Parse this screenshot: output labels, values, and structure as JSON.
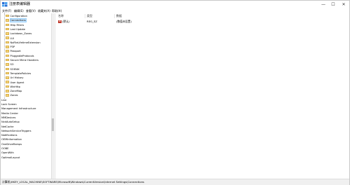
{
  "window": {
    "title": "注册表编辑器",
    "minimize": "—",
    "maximize": "☐",
    "close": "✕"
  },
  "menu": [
    "文件(F)",
    "编辑(E)",
    "查看(V)",
    "收藏夹(A)",
    "帮助(H)"
  ],
  "tree": {
    "items": [
      {
        "label": "Configuration",
        "depth": 1,
        "folder": true,
        "selected": false
      },
      {
        "label": "Connections",
        "depth": 1,
        "folder": true,
        "selected": true
      },
      {
        "label": "Http Filters",
        "depth": 1,
        "folder": true,
        "selected": false
      },
      {
        "label": "Last Update",
        "depth": 1,
        "folder": true,
        "selected": false
      },
      {
        "label": "Lockdown_Zones",
        "depth": 1,
        "folder": true,
        "selected": false
      },
      {
        "label": "LUI",
        "depth": 1,
        "folder": true,
        "selected": false
      },
      {
        "label": "NoFileLifetimeExtension",
        "depth": 1,
        "folder": true,
        "selected": false
      },
      {
        "label": "P3P",
        "depth": 1,
        "folder": true,
        "selected": false
      },
      {
        "label": "Passport",
        "depth": 1,
        "folder": true,
        "selected": false
      },
      {
        "label": "PluggableProtocols",
        "depth": 1,
        "folder": true,
        "selected": false
      },
      {
        "label": "Secure Mime Handlers",
        "depth": 1,
        "folder": true,
        "selected": false
      },
      {
        "label": "SO",
        "depth": 1,
        "folder": true,
        "selected": false
      },
      {
        "label": "SOIEAK",
        "depth": 1,
        "folder": true,
        "selected": false
      },
      {
        "label": "TemplatePolicies",
        "depth": 1,
        "folder": true,
        "selected": false
      },
      {
        "label": "Url History",
        "depth": 1,
        "folder": true,
        "selected": false
      },
      {
        "label": "User Agent",
        "depth": 1,
        "folder": true,
        "selected": false
      },
      {
        "label": "WinHttp",
        "depth": 1,
        "folder": true,
        "selected": false
      },
      {
        "label": "ZoneMap",
        "depth": 1,
        "folder": true,
        "selected": false
      },
      {
        "label": "Zones",
        "depth": 1,
        "folder": true,
        "selected": false
      },
      {
        "label": "Live",
        "depth": 0,
        "folder": false,
        "selected": false
      },
      {
        "label": "Lock Screen",
        "depth": 0,
        "folder": false,
        "selected": false
      },
      {
        "label": "Management Infrastructure",
        "depth": 0,
        "folder": false,
        "selected": false
      },
      {
        "label": "Media Center",
        "depth": 0,
        "folder": false,
        "selected": false
      },
      {
        "label": "MMDevices",
        "depth": 0,
        "folder": false,
        "selected": false
      },
      {
        "label": "NcdAutoSetup",
        "depth": 0,
        "folder": false,
        "selected": false
      },
      {
        "label": "NetCache",
        "depth": 0,
        "folder": false,
        "selected": false
      },
      {
        "label": "NetworkServiceTriggers",
        "depth": 0,
        "folder": false,
        "selected": false
      },
      {
        "label": "Notifications",
        "depth": 0,
        "folder": false,
        "selected": false
      },
      {
        "label": "OEMInformation",
        "depth": 0,
        "folder": false,
        "selected": false
      },
      {
        "label": "OneDriveRamps",
        "depth": 0,
        "folder": false,
        "selected": false
      },
      {
        "label": "OOBE",
        "depth": 0,
        "folder": false,
        "selected": false
      },
      {
        "label": "OpenWith",
        "depth": 0,
        "folder": false,
        "selected": false
      },
      {
        "label": "OptimalLayout",
        "depth": 0,
        "folder": false,
        "selected": false
      }
    ]
  },
  "list": {
    "columns": [
      "名称",
      "类型",
      "数据"
    ],
    "rows": [
      {
        "icon": "ab",
        "name": "(默认)",
        "type": "REG_SZ",
        "data": "(数值未设置)"
      }
    ]
  },
  "status": {
    "path": "计算机\\HKEY_LOCAL_MACHINE\\SOFTWARE\\Microsoft\\Windows\\CurrentVersion\\Internet Settings\\Connections"
  },
  "colors": {
    "selection": "#cce8ff",
    "folder": "#f5d47c"
  }
}
